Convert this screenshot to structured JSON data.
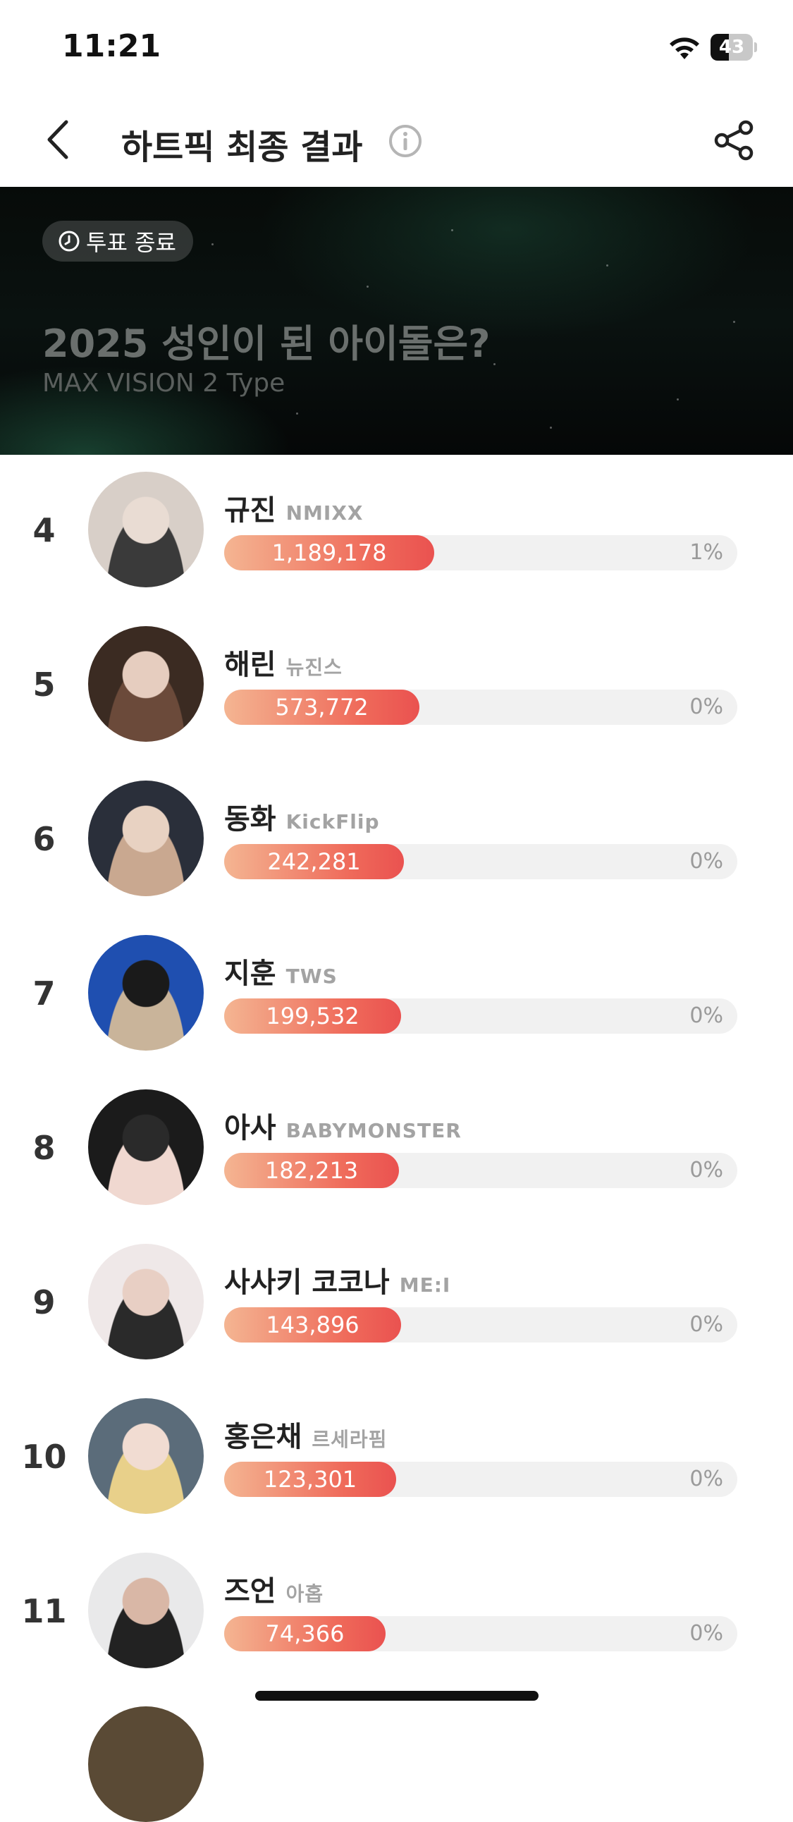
{
  "status_bar": {
    "time": "11:21",
    "battery_level": "43"
  },
  "nav": {
    "title": "하트픽 최종 결과"
  },
  "banner": {
    "badge": "투표 종료",
    "title": "2025 성인이 된 아이돌은?",
    "subtitle": "MAX VISION 2 Type"
  },
  "rankings": [
    {
      "rank": "4",
      "name": "규진",
      "group": "NMIXX",
      "votes": "1,189,178",
      "percent": "1%",
      "bar_fraction": 0.41
    },
    {
      "rank": "5",
      "name": "해린",
      "group": "뉴진스",
      "votes": "573,772",
      "percent": "0%",
      "bar_fraction": 0.38
    },
    {
      "rank": "6",
      "name": "동화",
      "group": "KickFlip",
      "votes": "242,281",
      "percent": "0%",
      "bar_fraction": 0.35
    },
    {
      "rank": "7",
      "name": "지훈",
      "group": "TWS",
      "votes": "199,532",
      "percent": "0%",
      "bar_fraction": 0.345
    },
    {
      "rank": "8",
      "name": "아사",
      "group": "BABYMONSTER",
      "votes": "182,213",
      "percent": "0%",
      "bar_fraction": 0.34
    },
    {
      "rank": "9",
      "name": "사사키 코코나",
      "group": "ME:I",
      "votes": "143,896",
      "percent": "0%",
      "bar_fraction": 0.345
    },
    {
      "rank": "10",
      "name": "홍은채",
      "group": "르세라핌",
      "votes": "123,301",
      "percent": "0%",
      "bar_fraction": 0.335
    },
    {
      "rank": "11",
      "name": "즈언",
      "group": "아홉",
      "votes": "74,366",
      "percent": "0%",
      "bar_fraction": 0.315
    }
  ],
  "colors": {
    "bar_start": "#f4b592",
    "bar_end": "#ea5250",
    "bar_track": "#f1f1f1",
    "banner_bg": "#070b09"
  }
}
